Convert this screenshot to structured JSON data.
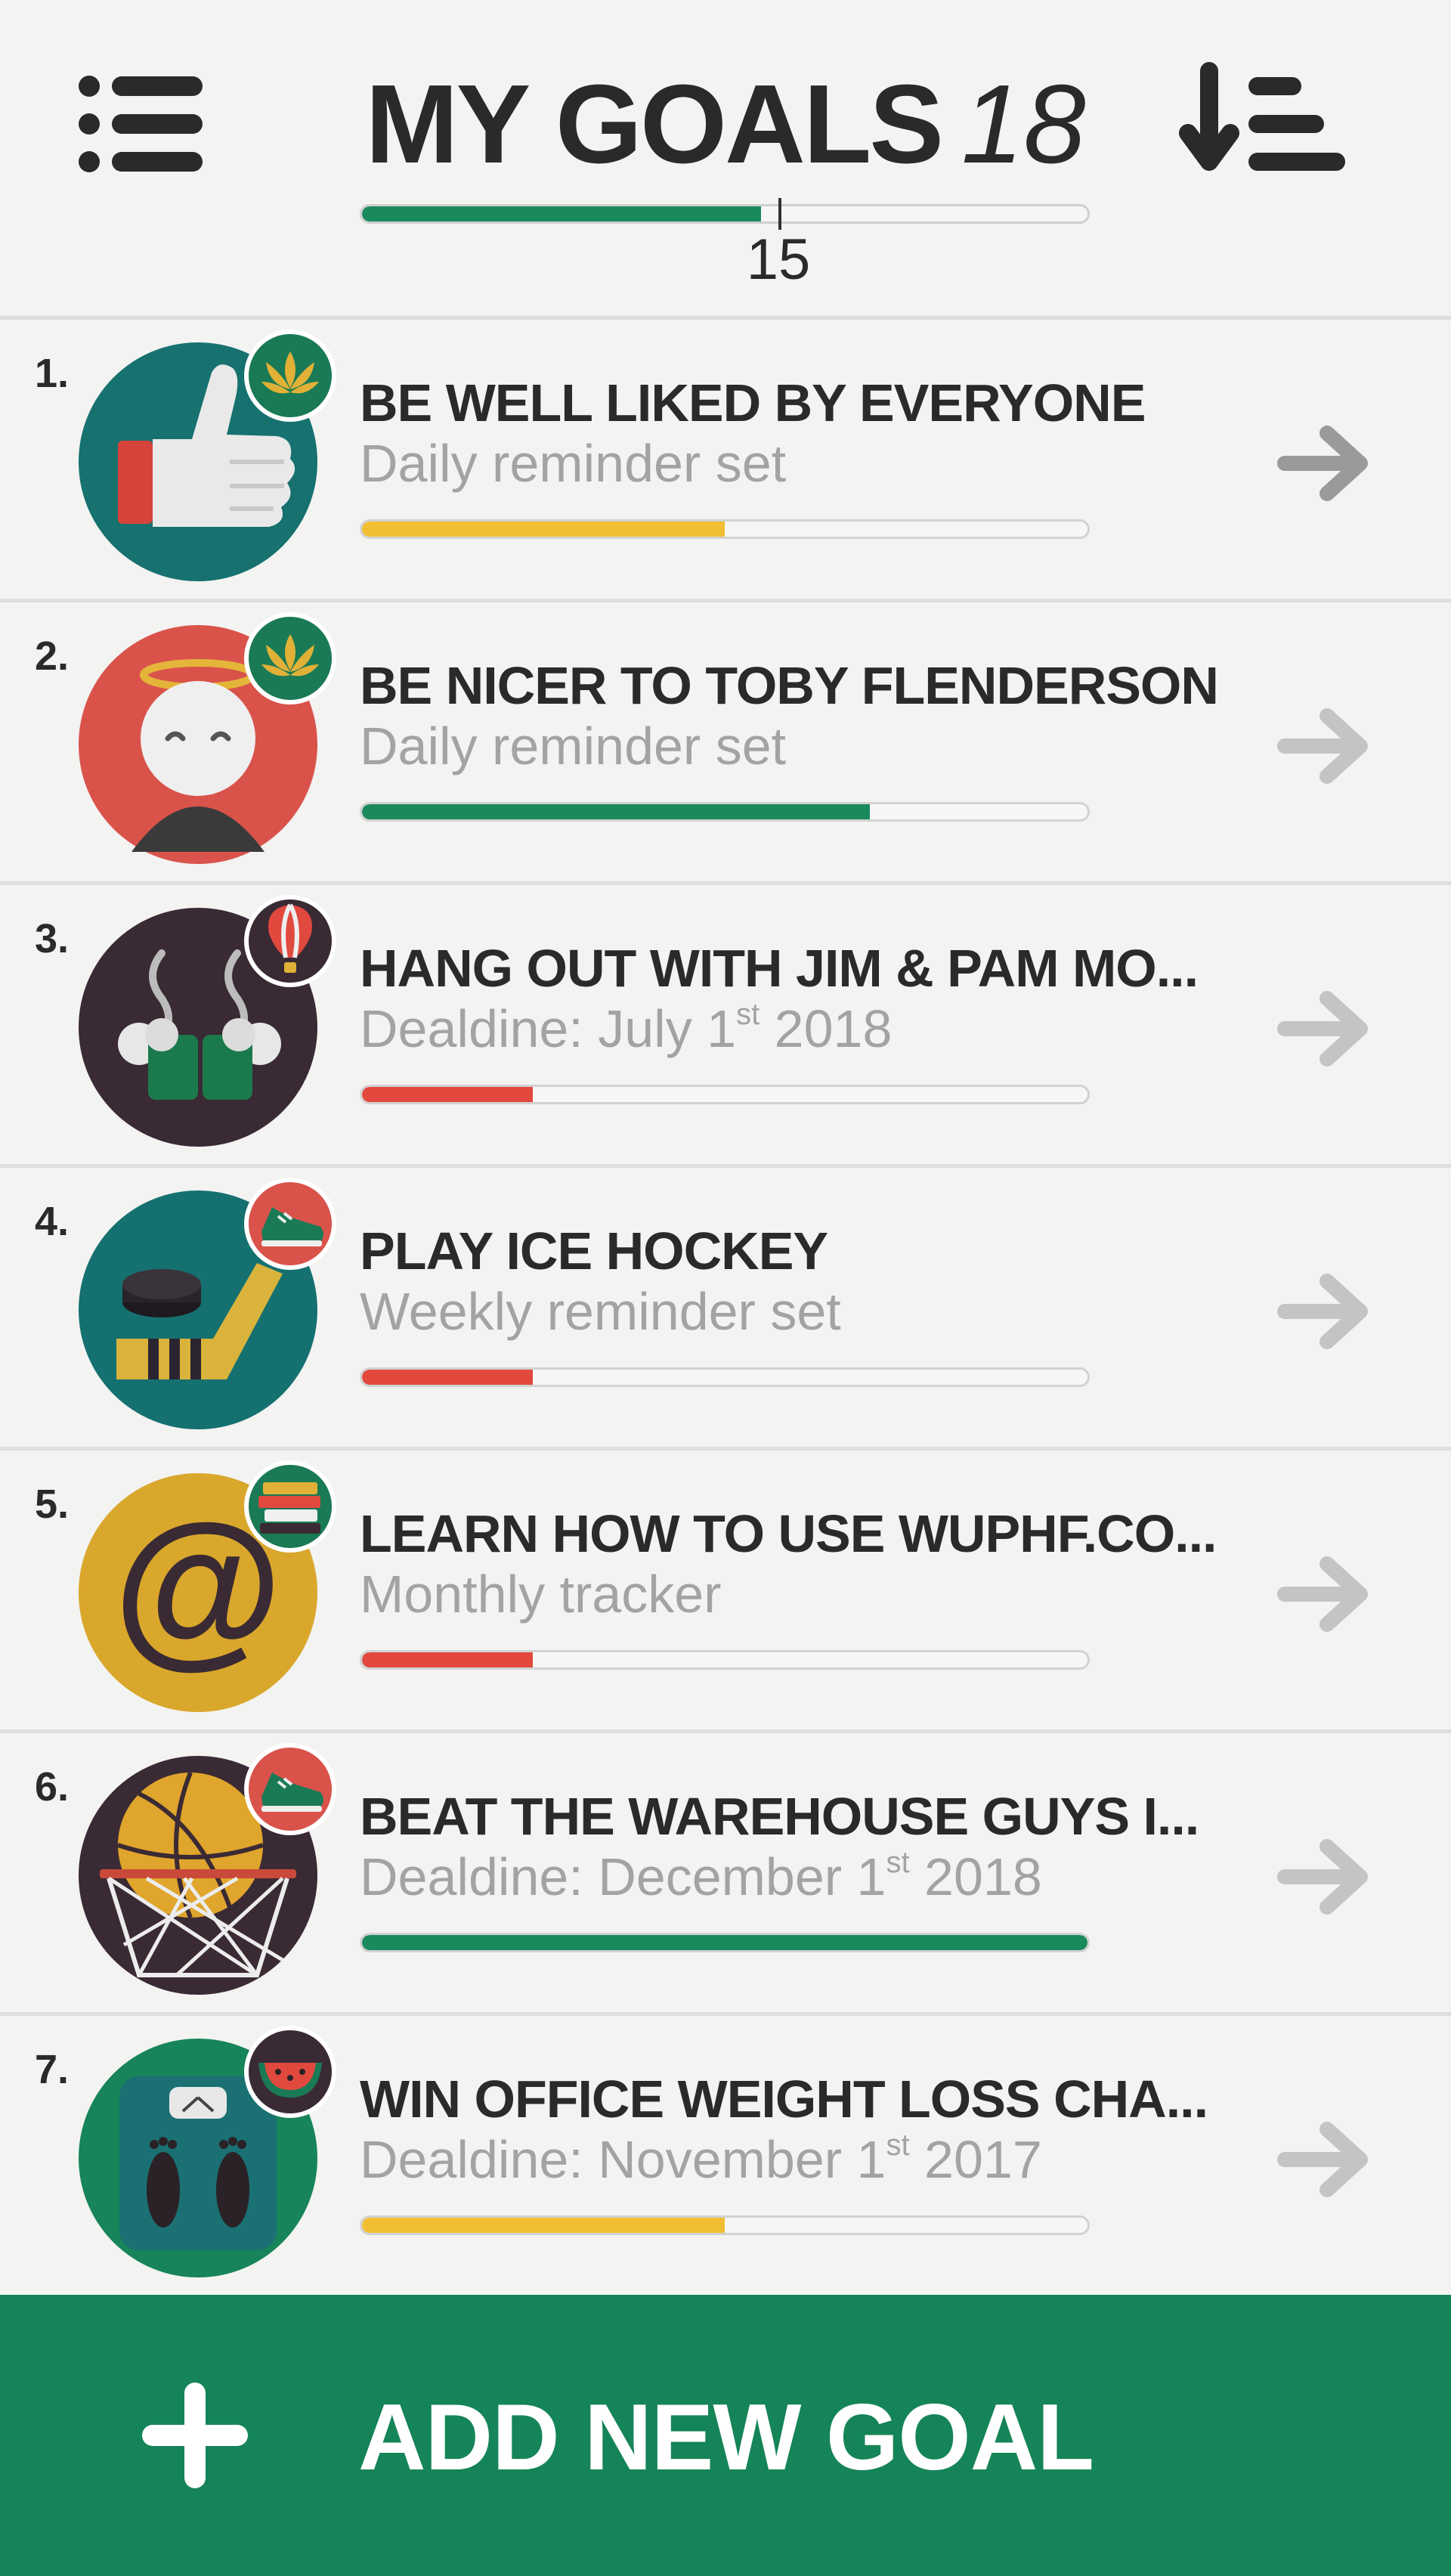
{
  "header": {
    "title": "MY GOALS",
    "count": "18",
    "progress_label": "15",
    "progress_fraction": 0.55
  },
  "goals": [
    {
      "num": "1.",
      "title": "BE WELL LIKED BY EVERYONE",
      "sub": "Daily reminder set",
      "sub_sup": "",
      "sub_tail": "",
      "progress": 0.5,
      "bar_color": "#f2bf33",
      "icon": "thumbs-up-icon",
      "badge": "lotus-badge-icon",
      "arrow_color": "#9a9a9a"
    },
    {
      "num": "2.",
      "title": "BE NICER TO TOBY FLENDERSON",
      "sub": "Daily reminder set",
      "sub_sup": "",
      "sub_tail": "",
      "progress": 0.7,
      "bar_color": "#1a8a5c",
      "icon": "angel-face-icon",
      "badge": "lotus-badge-icon",
      "arrow_color": "#c4c4c4"
    },
    {
      "num": "3.",
      "title": "HANG OUT WITH JIM & PAM MO...",
      "sub": "Dealdine: July 1",
      "sub_sup": "st",
      "sub_tail": " 2018",
      "progress": 0.235,
      "bar_color": "#e2483d",
      "icon": "coffee-mugs-icon",
      "badge": "hot-air-balloon-badge-icon",
      "arrow_color": "#c4c4c4"
    },
    {
      "num": "4.",
      "title": "PLAY ICE HOCKEY",
      "sub": "Weekly reminder set",
      "sub_sup": "",
      "sub_tail": "",
      "progress": 0.235,
      "bar_color": "#e2483d",
      "icon": "hockey-icon",
      "badge": "sneaker-badge-icon",
      "arrow_color": "#c4c4c4"
    },
    {
      "num": "5.",
      "title": "LEARN HOW TO USE WUPHF.CO...",
      "sub": "Monthly tracker",
      "sub_sup": "",
      "sub_tail": "",
      "progress": 0.235,
      "bar_color": "#e2483d",
      "icon": "at-sign-icon",
      "badge": "books-badge-icon",
      "arrow_color": "#c4c4c4"
    },
    {
      "num": "6.",
      "title": "BEAT THE WAREHOUSE GUYS I...",
      "sub": "Dealdine: December 1",
      "sub_sup": "st",
      "sub_tail": " 2018",
      "progress": 1.0,
      "bar_color": "#1a8a5c",
      "icon": "basketball-hoop-icon",
      "badge": "sneaker-badge-icon",
      "arrow_color": "#c4c4c4"
    },
    {
      "num": "7.",
      "title": "WIN OFFICE WEIGHT LOSS CHA...",
      "sub": "Dealdine: November 1",
      "sub_sup": "st",
      "sub_tail": " 2017",
      "progress": 0.5,
      "bar_color": "#f2bf33",
      "icon": "bathroom-scale-icon",
      "badge": "watermelon-badge-icon",
      "arrow_color": "#c4c4c4"
    }
  ],
  "footer": {
    "add_label": "ADD NEW GOAL"
  },
  "colors": {
    "brand_green": "#158458",
    "progress_green": "#1a8a5c",
    "progress_yellow": "#f2bf33",
    "progress_red": "#e2483d"
  }
}
